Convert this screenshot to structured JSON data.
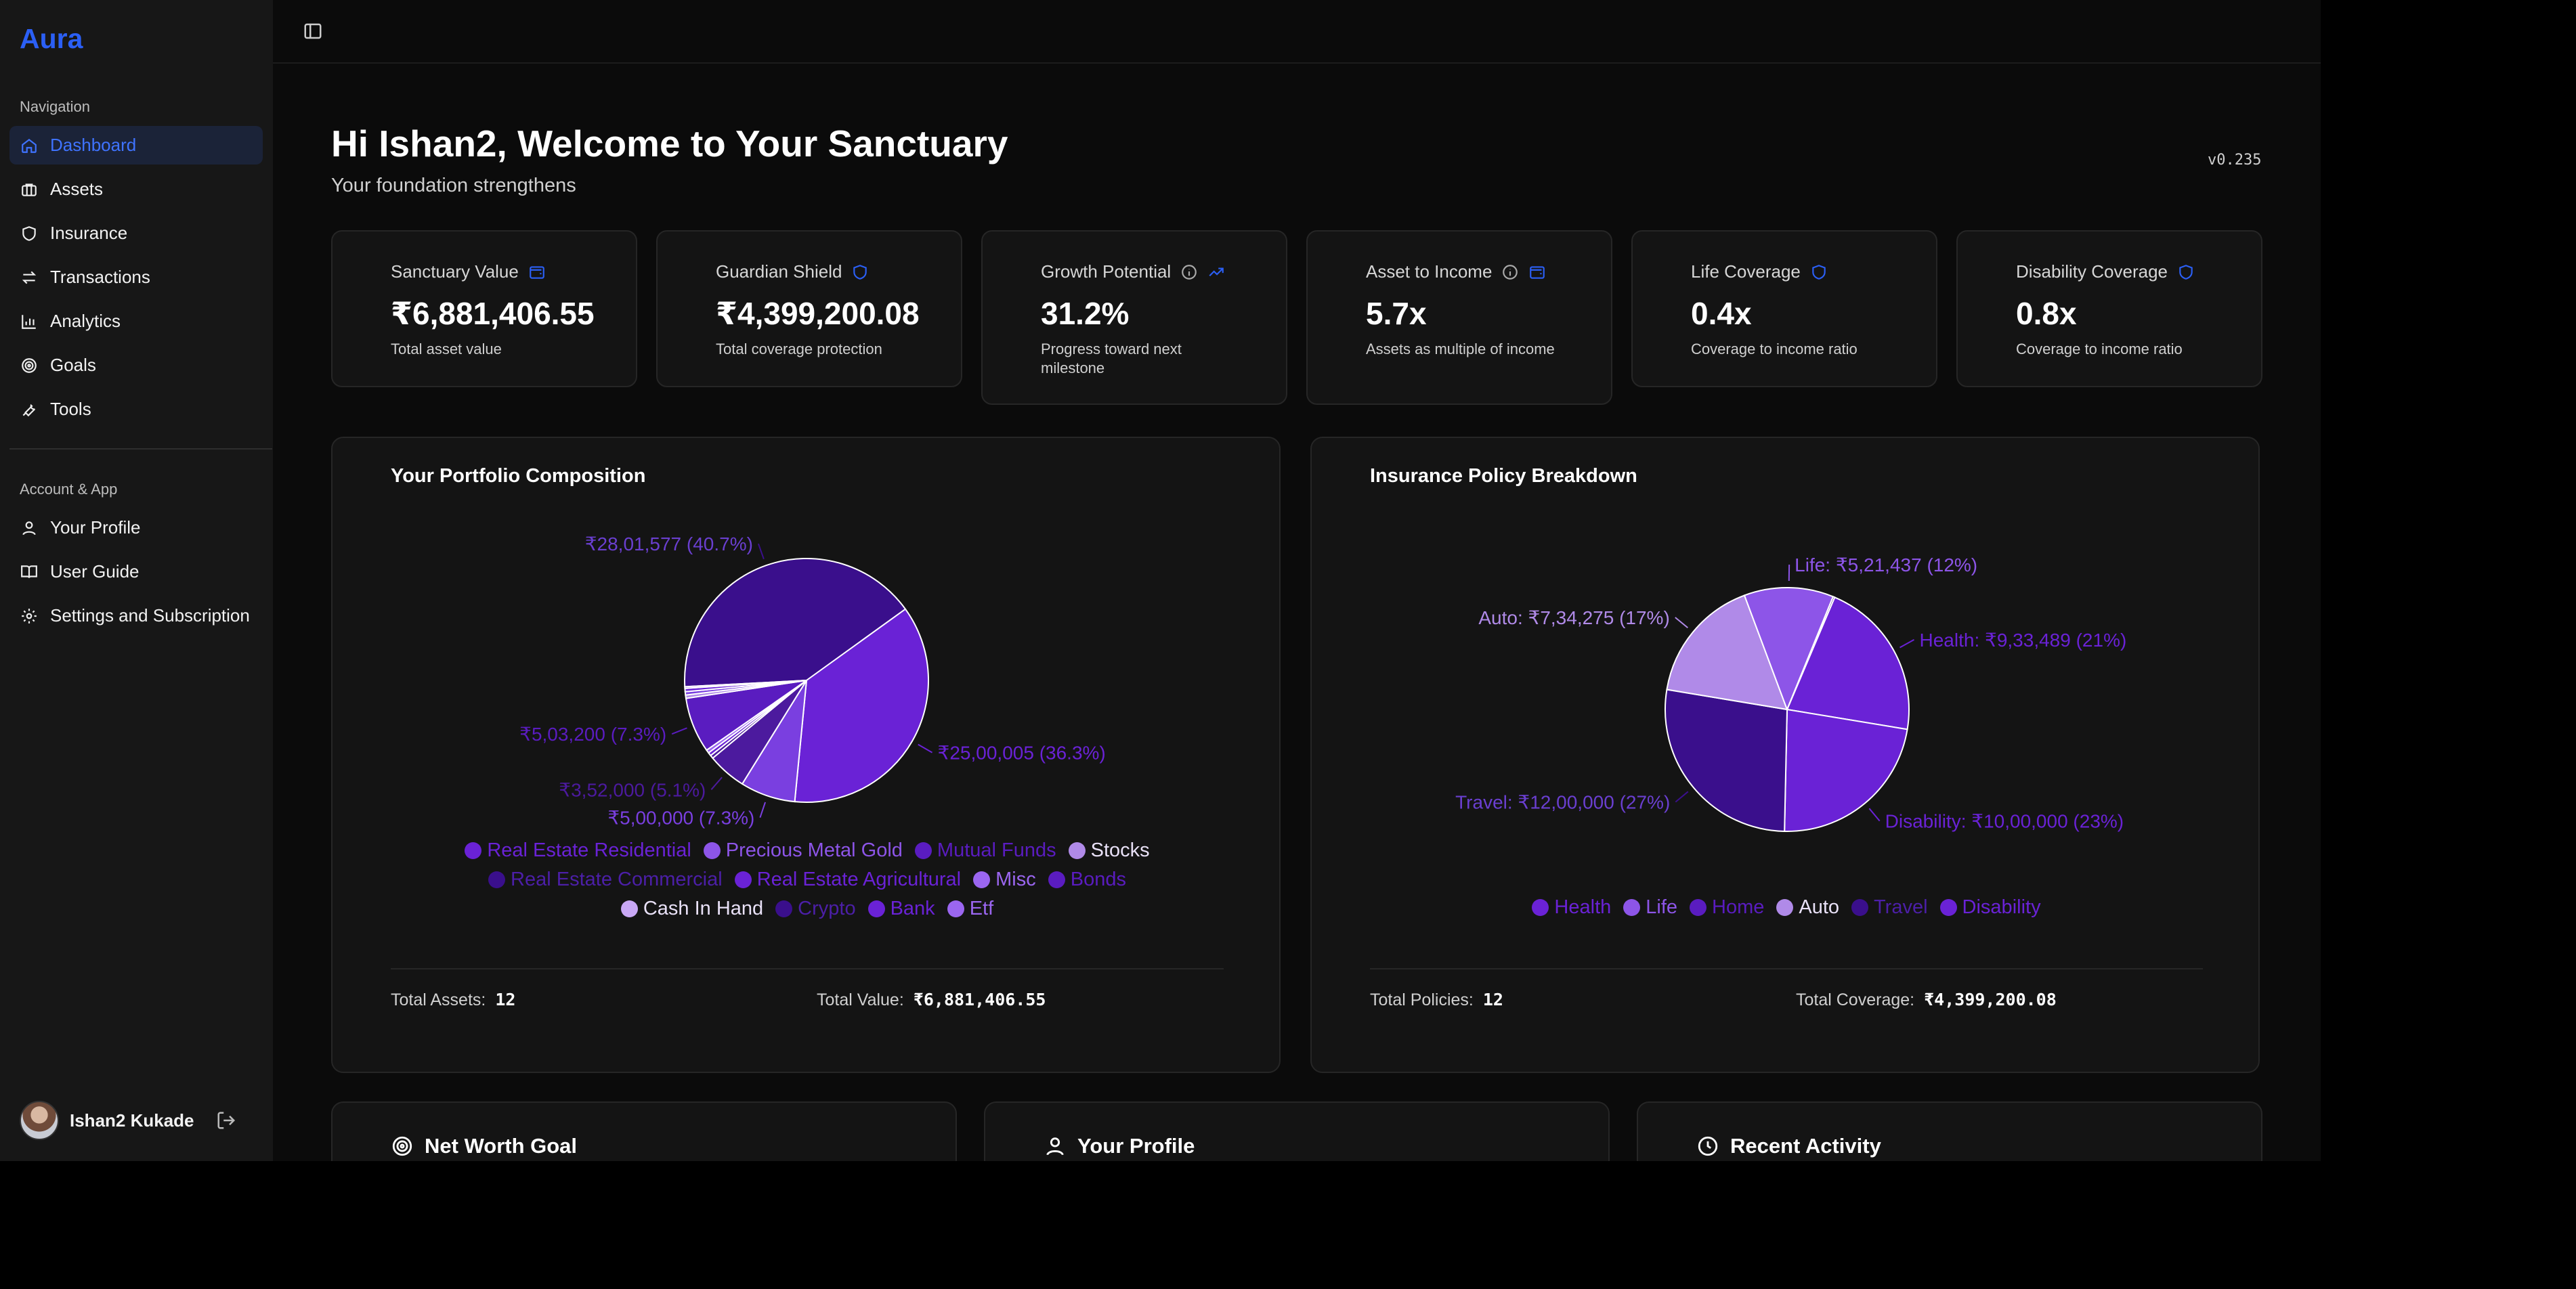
{
  "app": {
    "brand": "Aura",
    "version": "v0.235"
  },
  "sidebar": {
    "nav_label": "Navigation",
    "nav_items": [
      {
        "label": "Dashboard",
        "icon": "home-icon",
        "active": true
      },
      {
        "label": "Assets",
        "icon": "briefcase-icon"
      },
      {
        "label": "Insurance",
        "icon": "shield-icon"
      },
      {
        "label": "Transactions",
        "icon": "arrows-swap-icon"
      },
      {
        "label": "Analytics",
        "icon": "bar-chart-icon"
      },
      {
        "label": "Goals",
        "icon": "target-icon"
      },
      {
        "label": "Tools",
        "icon": "wrench-icon"
      }
    ],
    "account_label": "Account & App",
    "account_items": [
      {
        "label": "Your Profile",
        "icon": "user-icon"
      },
      {
        "label": "User Guide",
        "icon": "book-icon"
      },
      {
        "label": "Settings and Subscription",
        "icon": "gear-icon"
      }
    ],
    "user": {
      "name": "Ishan2 Kukade"
    }
  },
  "header": {
    "greeting": "Hi Ishan2, Welcome to Your Sanctuary",
    "subtitle": "Your foundation strengthens"
  },
  "stats": [
    {
      "label": "Sanctuary Value",
      "value": "₹6,881,406.55",
      "caption": "Total asset value",
      "icon": "wallet-icon"
    },
    {
      "label": "Guardian Shield",
      "value": "₹4,399,200.08",
      "caption": "Total coverage protection",
      "icon": "shield-icon"
    },
    {
      "label": "Growth Potential",
      "value": "31.2%",
      "caption": "Progress toward next milestone",
      "icon": "trending-up-icon",
      "info": true
    },
    {
      "label": "Asset to Income",
      "value": "5.7x",
      "caption": "Assets as multiple of income",
      "icon": "wallet-icon",
      "info": true
    },
    {
      "label": "Life Coverage",
      "value": "0.4x",
      "caption": "Coverage to income ratio",
      "icon": "shield-icon"
    },
    {
      "label": "Disability Coverage",
      "value": "0.8x",
      "caption": "Coverage to income ratio",
      "icon": "shield-icon"
    }
  ],
  "colors": {
    "accent": "#2b5ff5",
    "purple_1": "#3a0f8c",
    "purple_2": "#6a22d6",
    "purple_3": "#7a3fe0",
    "purple_4": "#9b66f0",
    "purple_5": "#b08ae8",
    "purple_6": "#4c1a9e"
  },
  "portfolio": {
    "title": "Your Portfolio Composition",
    "footer": {
      "assets_label": "Total Assets:",
      "assets_value": "12",
      "value_label": "Total Value:",
      "value_value": "₹6,881,406.55"
    }
  },
  "insurance": {
    "title": "Insurance Policy Breakdown",
    "footer": {
      "policies_label": "Total Policies:",
      "policies_value": "12",
      "coverage_label": "Total Coverage:",
      "coverage_value": "₹4,399,200.08"
    }
  },
  "chart_data": [
    {
      "type": "pie",
      "title": "Your Portfolio Composition",
      "series": [
        {
          "name": "Real Estate Residential",
          "value": 2801577,
          "label": "₹28,01,577 (40.7%)",
          "color": "#3a0f8c"
        },
        {
          "name": "Precious Metal Gold",
          "value": 2500005,
          "label": "₹25,00,005 (36.3%)",
          "color": "#6a22d6"
        },
        {
          "name": "Mutual Funds",
          "value": 500000,
          "label": "₹5,00,000 (7.3%)",
          "color": "#7a3fe0"
        },
        {
          "name": "Stocks",
          "value": 352000,
          "label": "₹3,52,000 (5.1%)",
          "color": "#4c1a9e"
        },
        {
          "name": "Real Estate Commercial",
          "value": 30000,
          "label": "",
          "color": "#4c1a9e"
        },
        {
          "name": "Real Estate Agricultural",
          "value": 30000,
          "label": "",
          "color": "#6a22d6"
        },
        {
          "name": "Misc",
          "value": 30000,
          "label": "",
          "color": "#9b66f0"
        },
        {
          "name": "Bonds",
          "value": 503200,
          "label": "₹5,03,200 (7.3%)",
          "color": "#5a1cc0"
        },
        {
          "name": "Cash In Hand",
          "value": 30000,
          "label": "",
          "color": "#b08ae8"
        },
        {
          "name": "Crypto",
          "value": 30000,
          "label": "",
          "color": "#7a3fe0"
        },
        {
          "name": "Bank",
          "value": 30000,
          "label": "",
          "color": "#6a22d6"
        },
        {
          "name": "Etf",
          "value": 14624,
          "label": "",
          "color": "#9b66f0"
        }
      ],
      "legend": [
        {
          "name": "Real Estate Residential",
          "color": "#6a22d6"
        },
        {
          "name": "Precious Metal Gold",
          "color": "#8d55e8"
        },
        {
          "name": "Mutual Funds",
          "color": "#5a1cc0"
        },
        {
          "name": "Stocks",
          "color": "#b08ae8"
        },
        {
          "name": "Real Estate Commercial",
          "color": "#3a0f8c"
        },
        {
          "name": "Real Estate Agricultural",
          "color": "#6a22d6"
        },
        {
          "name": "Misc",
          "color": "#9b66f0"
        },
        {
          "name": "Bonds",
          "color": "#5a1cc0"
        },
        {
          "name": "Cash In Hand",
          "color": "#c9a8f5"
        },
        {
          "name": "Crypto",
          "color": "#3a0f8c"
        },
        {
          "name": "Bank",
          "color": "#6a22d6"
        },
        {
          "name": "Etf",
          "color": "#9b66f0"
        }
      ],
      "legend_position": "bottom"
    },
    {
      "type": "pie",
      "title": "Insurance Policy Breakdown",
      "series": [
        {
          "name": "Health",
          "value": 933489,
          "label": "Health: ₹9,33,489 (21%)",
          "color": "#6a22d6"
        },
        {
          "name": "Disability",
          "value": 1000000,
          "label": "Disability: ₹10,00,000 (23%)",
          "color": "#6a22d6"
        },
        {
          "name": "Travel",
          "value": 1200000,
          "label": "Travel: ₹12,00,000 (27%)",
          "color": "#3a0f8c"
        },
        {
          "name": "Auto",
          "value": 734275,
          "label": "Auto: ₹7,34,275 (17%)",
          "color": "#b08ae8"
        },
        {
          "name": "Life",
          "value": 521437,
          "label": "Life: ₹5,21,437 (12%)",
          "color": "#8d55e8"
        },
        {
          "name": "Home",
          "value": 10000,
          "label": "",
          "color": "#4c1a9e"
        }
      ],
      "legend": [
        {
          "name": "Health",
          "color": "#6a22d6"
        },
        {
          "name": "Life",
          "color": "#8d55e8"
        },
        {
          "name": "Home",
          "color": "#5a1cc0"
        },
        {
          "name": "Auto",
          "color": "#b08ae8"
        },
        {
          "name": "Travel",
          "color": "#3a0f8c"
        },
        {
          "name": "Disability",
          "color": "#6a22d6"
        }
      ],
      "legend_position": "bottom"
    }
  ],
  "bottom_cards": [
    {
      "title": "Net Worth Goal",
      "icon": "target-icon"
    },
    {
      "title": "Your Profile",
      "icon": "user-icon"
    },
    {
      "title": "Recent Activity",
      "icon": "clock-icon"
    }
  ]
}
